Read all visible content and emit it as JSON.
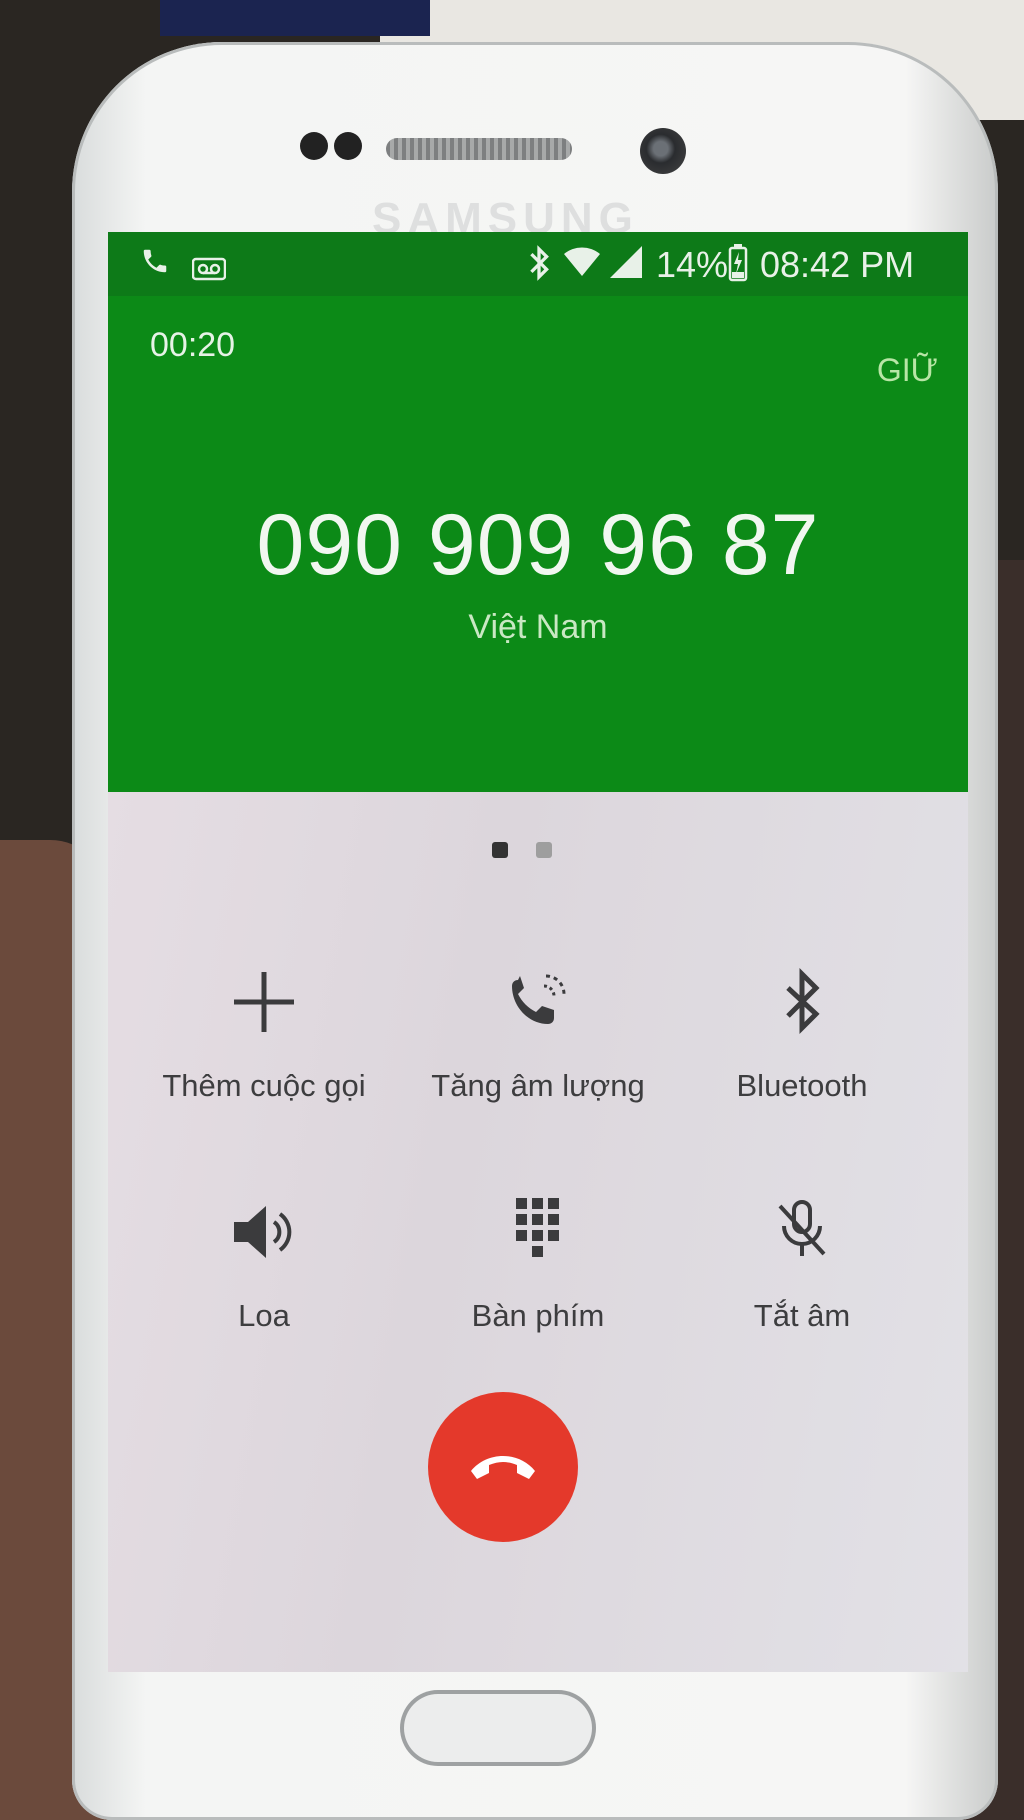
{
  "device": {
    "brand_text": "SAMSUNG"
  },
  "status_bar": {
    "battery_percent": "14%",
    "time": "08:42 PM",
    "icons": [
      "phone-icon",
      "voicemail-icon",
      "bluetooth-icon",
      "wifi-icon",
      "signal-icon",
      "battery-charging-icon"
    ]
  },
  "call": {
    "duration": "00:20",
    "hold_label": "GIỮ",
    "phone_number": "090 909 96 87",
    "country": "Việt Nam"
  },
  "pager": {
    "pages": 2,
    "active_index": 0
  },
  "controls": [
    {
      "label": "Thêm cuộc gọi",
      "icon": "add-icon"
    },
    {
      "label": "Tăng âm lượng",
      "icon": "volume-boost-icon"
    },
    {
      "label": "Bluetooth",
      "icon": "bluetooth-icon"
    },
    {
      "label": "Loa",
      "icon": "speaker-icon"
    },
    {
      "label": "Bàn phím",
      "icon": "keypad-icon"
    },
    {
      "label": "Tắt âm",
      "icon": "mute-icon"
    }
  ],
  "end_call": {
    "icon": "end-call-icon"
  },
  "colors": {
    "header_green": "#0c8a17",
    "end_call_red": "#e4392b"
  }
}
